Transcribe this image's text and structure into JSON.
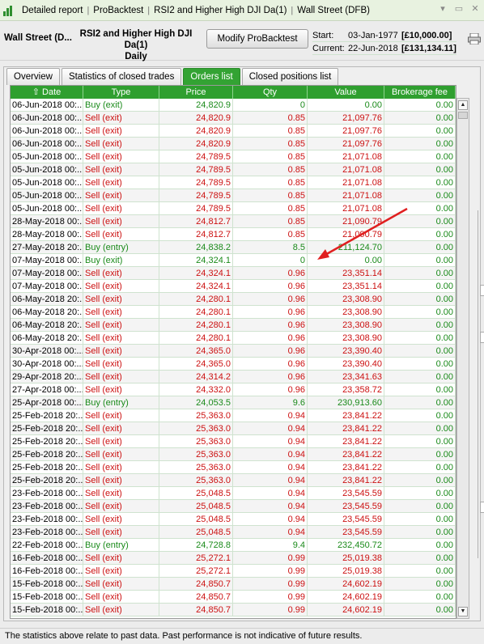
{
  "titlebar": {
    "crumbs": [
      "Detailed report",
      "ProBacktest",
      "RSI2 and Higher High DJI Da(1)",
      "Wall Street (DFB)"
    ],
    "controls": [
      "▾",
      "▭",
      "✕"
    ]
  },
  "header": {
    "instrument": "Wall Street (D...",
    "system_line1": "RSI2 and Higher High DJI Da(1)",
    "system_line2": "Daily",
    "modify_label": "Modify ProBacktest",
    "start_label": "Start:",
    "start_date": "03-Jan-1977",
    "start_capital": "[£10,000.00]",
    "current_label": "Current:",
    "current_date": "22-Jun-2018",
    "current_capital": "[£131,134.11]"
  },
  "tabs": [
    {
      "label": "Overview",
      "active": false
    },
    {
      "label": "Statistics of closed trades",
      "active": false
    },
    {
      "label": "Orders list",
      "active": true
    },
    {
      "label": "Closed positions list",
      "active": false
    }
  ],
  "table": {
    "columns": [
      "Date",
      "Type",
      "Price",
      "Qty",
      "Value",
      "Brokerage fee"
    ],
    "sort_indicator": "⇧",
    "rows": [
      [
        "06-Jun-2018 00:...",
        "Buy (exit)",
        "24,820.9",
        "0",
        "0.00",
        "0.00"
      ],
      [
        "06-Jun-2018 00:...",
        "Sell (exit)",
        "24,820.9",
        "0.85",
        "21,097.76",
        "0.00"
      ],
      [
        "06-Jun-2018 00:...",
        "Sell (exit)",
        "24,820.9",
        "0.85",
        "21,097.76",
        "0.00"
      ],
      [
        "06-Jun-2018 00:...",
        "Sell (exit)",
        "24,820.9",
        "0.85",
        "21,097.76",
        "0.00"
      ],
      [
        "05-Jun-2018 00:...",
        "Sell (exit)",
        "24,789.5",
        "0.85",
        "21,071.08",
        "0.00"
      ],
      [
        "05-Jun-2018 00:...",
        "Sell (exit)",
        "24,789.5",
        "0.85",
        "21,071.08",
        "0.00"
      ],
      [
        "05-Jun-2018 00:...",
        "Sell (exit)",
        "24,789.5",
        "0.85",
        "21,071.08",
        "0.00"
      ],
      [
        "05-Jun-2018 00:...",
        "Sell (exit)",
        "24,789.5",
        "0.85",
        "21,071.08",
        "0.00"
      ],
      [
        "05-Jun-2018 00:...",
        "Sell (exit)",
        "24,789.5",
        "0.85",
        "21,071.08",
        "0.00"
      ],
      [
        "28-May-2018 00:...",
        "Sell (exit)",
        "24,812.7",
        "0.85",
        "21,090.79",
        "0.00"
      ],
      [
        "28-May-2018 00:...",
        "Sell (exit)",
        "24,812.7",
        "0.85",
        "21,090.79",
        "0.00"
      ],
      [
        "27-May-2018 20:...",
        "Buy (entry)",
        "24,838.2",
        "8.5",
        "211,124.70",
        "0.00"
      ],
      [
        "07-May-2018 00:...",
        "Buy (exit)",
        "24,324.1",
        "0",
        "0.00",
        "0.00"
      ],
      [
        "07-May-2018 00:...",
        "Sell (exit)",
        "24,324.1",
        "0.96",
        "23,351.14",
        "0.00"
      ],
      [
        "07-May-2018 00:...",
        "Sell (exit)",
        "24,324.1",
        "0.96",
        "23,351.14",
        "0.00"
      ],
      [
        "06-May-2018 20:...",
        "Sell (exit)",
        "24,280.1",
        "0.96",
        "23,308.90",
        "0.00"
      ],
      [
        "06-May-2018 20:...",
        "Sell (exit)",
        "24,280.1",
        "0.96",
        "23,308.90",
        "0.00"
      ],
      [
        "06-May-2018 20:...",
        "Sell (exit)",
        "24,280.1",
        "0.96",
        "23,308.90",
        "0.00"
      ],
      [
        "06-May-2018 20:...",
        "Sell (exit)",
        "24,280.1",
        "0.96",
        "23,308.90",
        "0.00"
      ],
      [
        "30-Apr-2018 00:...",
        "Sell (exit)",
        "24,365.0",
        "0.96",
        "23,390.40",
        "0.00"
      ],
      [
        "30-Apr-2018 00:...",
        "Sell (exit)",
        "24,365.0",
        "0.96",
        "23,390.40",
        "0.00"
      ],
      [
        "29-Apr-2018 20:...",
        "Sell (exit)",
        "24,314.2",
        "0.96",
        "23,341.63",
        "0.00"
      ],
      [
        "27-Apr-2018 00:...",
        "Sell (exit)",
        "24,332.0",
        "0.96",
        "23,358.72",
        "0.00"
      ],
      [
        "25-Apr-2018 00:...",
        "Buy (entry)",
        "24,053.5",
        "9.6",
        "230,913.60",
        "0.00"
      ],
      [
        "25-Feb-2018 20:...",
        "Sell (exit)",
        "25,363.0",
        "0.94",
        "23,841.22",
        "0.00"
      ],
      [
        "25-Feb-2018 20:...",
        "Sell (exit)",
        "25,363.0",
        "0.94",
        "23,841.22",
        "0.00"
      ],
      [
        "25-Feb-2018 20:...",
        "Sell (exit)",
        "25,363.0",
        "0.94",
        "23,841.22",
        "0.00"
      ],
      [
        "25-Feb-2018 20:...",
        "Sell (exit)",
        "25,363.0",
        "0.94",
        "23,841.22",
        "0.00"
      ],
      [
        "25-Feb-2018 20:...",
        "Sell (exit)",
        "25,363.0",
        "0.94",
        "23,841.22",
        "0.00"
      ],
      [
        "25-Feb-2018 20:...",
        "Sell (exit)",
        "25,363.0",
        "0.94",
        "23,841.22",
        "0.00"
      ],
      [
        "23-Feb-2018 00:...",
        "Sell (exit)",
        "25,048.5",
        "0.94",
        "23,545.59",
        "0.00"
      ],
      [
        "23-Feb-2018 00:...",
        "Sell (exit)",
        "25,048.5",
        "0.94",
        "23,545.59",
        "0.00"
      ],
      [
        "23-Feb-2018 00:...",
        "Sell (exit)",
        "25,048.5",
        "0.94",
        "23,545.59",
        "0.00"
      ],
      [
        "23-Feb-2018 00:...",
        "Sell (exit)",
        "25,048.5",
        "0.94",
        "23,545.59",
        "0.00"
      ],
      [
        "22-Feb-2018 00:...",
        "Buy (entry)",
        "24,728.8",
        "9.4",
        "232,450.72",
        "0.00"
      ],
      [
        "16-Feb-2018 00:...",
        "Sell (exit)",
        "25,272.1",
        "0.99",
        "25,019.38",
        "0.00"
      ],
      [
        "16-Feb-2018 00:...",
        "Sell (exit)",
        "25,272.1",
        "0.99",
        "25,019.38",
        "0.00"
      ],
      [
        "15-Feb-2018 00:...",
        "Sell (exit)",
        "24,850.7",
        "0.99",
        "24,602.19",
        "0.00"
      ],
      [
        "15-Feb-2018 00:...",
        "Sell (exit)",
        "24,850.7",
        "0.99",
        "24,602.19",
        "0.00"
      ],
      [
        "15-Feb-2018 00:...",
        "Sell (exit)",
        "24,850.7",
        "0.99",
        "24,602.19",
        "0.00"
      ]
    ]
  },
  "colors": {
    "buy": "#1a8a1a",
    "sell": "#cc1111",
    "header_green": "#2f9f2f",
    "arrow": "#e02020"
  },
  "footer": {
    "disclaimer": "The statistics above relate to past data. Past performance is not indicative of future results."
  }
}
